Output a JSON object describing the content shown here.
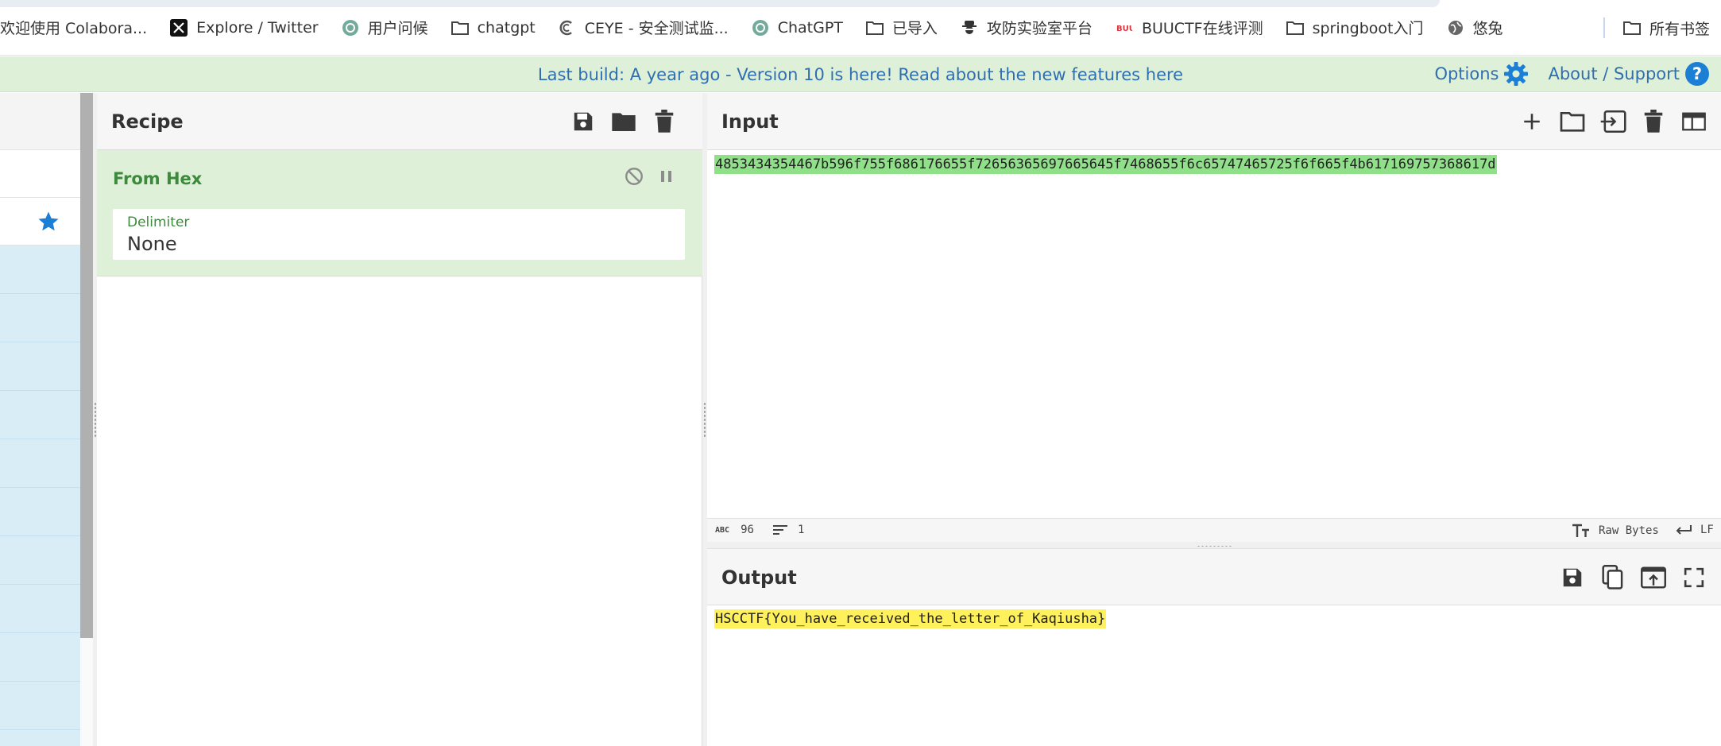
{
  "bookmarks": [
    {
      "label": "欢迎使用 Colabora...",
      "icon": "none"
    },
    {
      "label": "Explore / Twitter",
      "icon": "x-logo-icon"
    },
    {
      "label": "用户问候",
      "icon": "chatgpt-icon"
    },
    {
      "label": "chatgpt",
      "icon": "folder-icon"
    },
    {
      "label": "CEYE - 安全测试监...",
      "icon": "ceye-icon"
    },
    {
      "label": "ChatGPT",
      "icon": "chatgpt-icon"
    },
    {
      "label": "已导入",
      "icon": "folder-icon"
    },
    {
      "label": "攻防实验室平台",
      "icon": "spy-icon"
    },
    {
      "label": "BUUCTF在线评测",
      "icon": "buuctf-icon"
    },
    {
      "label": "springboot入门",
      "icon": "folder-icon"
    },
    {
      "label": "悠兔",
      "icon": "globe-icon"
    }
  ],
  "bookmarks_all": "所有书签",
  "notice": {
    "prefix": "Last build: A year ago - Version 10 is here! Read about the new features ",
    "link": "here"
  },
  "top_links": {
    "options": "Options",
    "about": "About / Support"
  },
  "recipe": {
    "title": "Recipe",
    "operation": {
      "name": "From Hex",
      "field_label": "Delimiter",
      "field_value": "None"
    }
  },
  "input": {
    "title": "Input",
    "text": "4853434354467b596f755f686176655f72656365697665645f7468655f6c65747465725f6f665f4b617169757368617d",
    "status": {
      "length": "96",
      "lines": "1",
      "encoding": "Raw Bytes",
      "eol": "LF"
    }
  },
  "output": {
    "title": "Output",
    "text": "HSCCTF{You_have_received_the_letter_of_Kaqiusha}"
  },
  "colors": {
    "banner_bg": "#dff0d8",
    "link": "#2f6fb0",
    "op_title": "#3c8a3c",
    "input_highlight": "#90e08a",
    "output_highlight": "#fff15c",
    "ops_list_bg": "#d9edf7",
    "star": "#1c7fd6"
  }
}
